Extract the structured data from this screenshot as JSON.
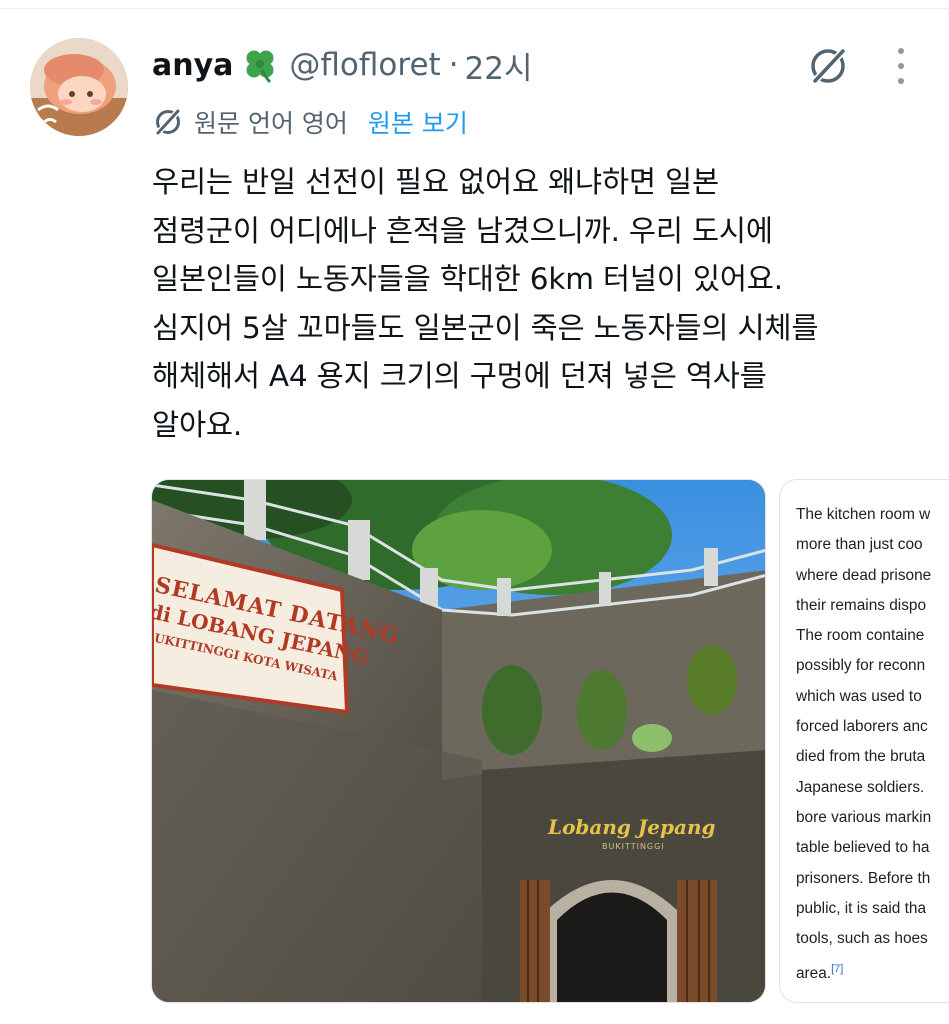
{
  "author": {
    "name": "anya",
    "handle": "@flofloret",
    "separator": "·",
    "time": "22시"
  },
  "icons": {
    "clover": "four-leaf-clover-emoji",
    "grok": "grok-icon",
    "more": "more-vertical-icon",
    "translate": "translate-icon"
  },
  "translation": {
    "language_label": "원문 언어 영어",
    "view_original": "원본 보기"
  },
  "tweet": {
    "text": "우리는 반일 선전이 필요 없어요 왜냐하면 일본\n점령군이 어디에나 흔적을 남겼으니까. 우리 도시에\n일본인들이 노동자들을 학대한 6km 터널이 있어요.\n심지어 5살 꼬마들도 일본군이 죽은 노동자들의 시체를\n해체해서 A4 용지 크기의 구멍에 던져 넣은 역사를\n알아요."
  },
  "photo": {
    "sign_line1": "SELAMAT DATANG",
    "sign_line2": "di LOBANG JEPANG",
    "sign_line3": "BUKITTINGGI KOTA WISATA",
    "tunnel_sign": "Lobang Jepang",
    "tunnel_subsign": "BUKITTINGGI"
  },
  "wiki_snippet": {
    "text": "The kitchen room w\nmore than just coo\nwhere dead prisone\ntheir remains dispo\nThe room containe\npossibly for reconn\nwhich was used to \nforced laborers anc\ndied from the bruta\nJapanese soldiers. \nbore various markin\ntable believed to ha\nprisoners. Before th\npublic, it is said tha\ntools, such as hoes\narea.",
    "citation": "[7]"
  },
  "colors": {
    "link": "#1d9bf0",
    "muted": "#536471",
    "text": "#0f1419",
    "wiki_link": "#3366cc"
  }
}
